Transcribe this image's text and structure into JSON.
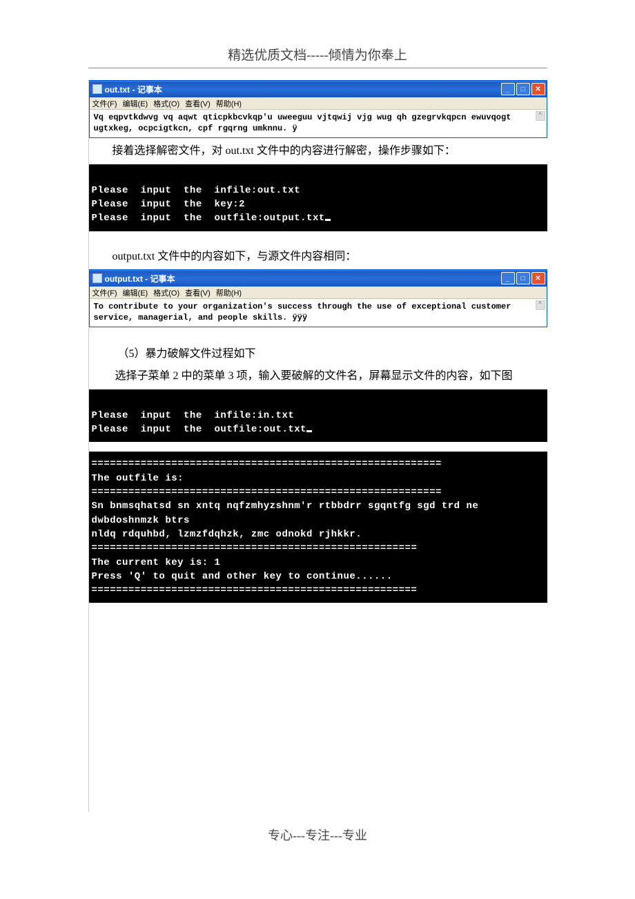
{
  "header": "精选优质文档-----倾情为你奉上",
  "footer": "专心---专注---专业",
  "notepad1": {
    "title": "out.txt - 记事本",
    "menu": {
      "file": "文件(F)",
      "edit": "编辑(E)",
      "format": "格式(O)",
      "view": "查看(V)",
      "help": "帮助(H)"
    },
    "body": "Vq eqpvtkdwvg vq aqwt qticpkbcvkqp'u uweeguu vjtqwij vjg wug qh gzegrvkqpcn ewuvqogt\nugtxkeg, ocpcigtkcn, cpf rgqrng umknnu. ÿ"
  },
  "para1": "接着选择解密文件，对 out.txt 文件中的内容进行解密，操作步骤如下：",
  "console1": "\nPlease  input  the  infile:out.txt\nPlease  input  the  key:2\nPlease  input  the  outfile:output.txt",
  "para2": "output.txt 文件中的内容如下，与源文件内容相同：",
  "notepad2": {
    "title": "output.txt - 记事本",
    "menu": {
      "file": "文件(F)",
      "edit": "编辑(E)",
      "format": "格式(O)",
      "view": "查看(V)",
      "help": "帮助(H)"
    },
    "body": "To contribute to your organization's success through the use of exceptional customer\nservice, managerial, and people skills. ÿÿÿ"
  },
  "para3a": "（5）暴力破解文件过程如下",
  "para3b": "选择子菜单 2 中的菜单 3 项，输入要破解的文件名，屏幕显示文件的内容，如下图",
  "console2": "\nPlease  input  the  infile:in.txt\nPlease  input  the  outfile:out.txt",
  "console3": "=========================================================\nThe outfile is:\n=========================================================\nSn bnmsqhatsd sn xntq nqfzmhyzshnm'r rtbbdrr sgqntfg sgd trd ne dwbdoshnmzk btrs\nnldq rdquhbd, lzmzfdqhzk, zmc odnokd rjhkkr.\n=====================================================\nThe current key is: 1\nPress 'Q' to quit and other key to continue......\n====================================================="
}
